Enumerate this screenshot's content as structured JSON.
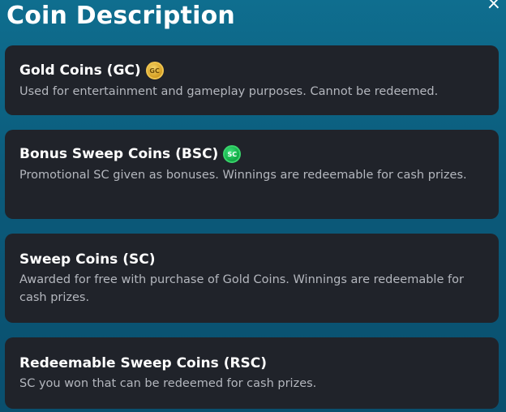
{
  "header": {
    "title": "Coin Description",
    "close_glyph": "×"
  },
  "cards": [
    {
      "title": "Gold Coins (GC)",
      "badge": "GC",
      "badge_icon": "gold-coin-icon",
      "badge_color": "#d9a52a",
      "description": "Used for entertainment and gameplay purposes. Cannot be redeemed."
    },
    {
      "title": "Bonus Sweep Coins (BSC)",
      "badge": "SC",
      "badge_icon": "sweep-coin-icon",
      "badge_color": "#15b04a",
      "description": "Promotional SC given as bonuses. Winnings are redeemable for cash prizes."
    },
    {
      "title": "Sweep Coins (SC)",
      "description": "Awarded for free with purchase of Gold Coins. Winnings are redeemable for cash prizes."
    },
    {
      "title": "Redeemable Sweep Coins (RSC)",
      "description": "SC you won that can be redeemed for cash prizes."
    }
  ],
  "colors": {
    "background": "#0b5a7a",
    "card": "#20232a",
    "title_text": "#ffffff",
    "description_text": "#b4b7be"
  }
}
